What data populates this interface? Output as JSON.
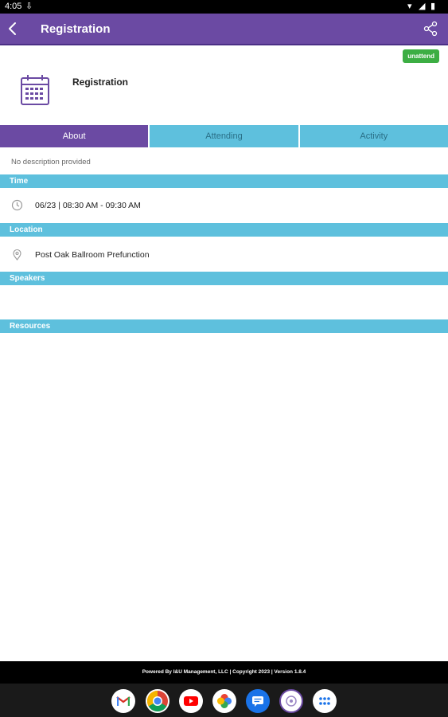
{
  "status_bar": {
    "time": "4:05"
  },
  "app_bar": {
    "title": "Registration"
  },
  "event": {
    "title": "Registration",
    "badge": "unattend"
  },
  "tabs": [
    {
      "label": "About"
    },
    {
      "label": "Attending"
    },
    {
      "label": "Activity"
    }
  ],
  "about": {
    "description": "No description provided",
    "time_header": "Time",
    "time_value": "06/23 | 08:30 AM - 09:30 AM",
    "location_header": "Location",
    "location_value": "Post Oak Ballroom Prefunction",
    "speakers_header": "Speakers",
    "resources_header": "Resources"
  },
  "footer": {
    "text": "Powered By I&U Management, LLC | Copyright 2023 | Version 1.8.4"
  },
  "dock": [
    "gmail-icon",
    "chrome-icon",
    "youtube-icon",
    "photos-icon",
    "messages-icon",
    "event-app-icon",
    "app-drawer-icon"
  ],
  "colors": {
    "primary": "#6b4aa3",
    "accent": "#5ec0dd",
    "badge": "#3cae43"
  }
}
